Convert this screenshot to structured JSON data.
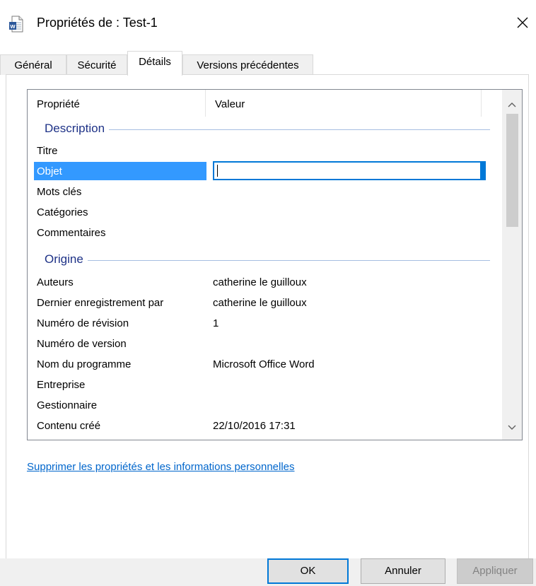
{
  "window": {
    "title": "Propriétés de : Test-1",
    "icon": "word-document-icon",
    "close_symbol": "close-icon"
  },
  "tabs": [
    {
      "label": "Général",
      "active": false
    },
    {
      "label": "Sécurité",
      "active": false
    },
    {
      "label": "Détails",
      "active": true
    },
    {
      "label": "Versions précédentes",
      "active": false
    }
  ],
  "list": {
    "columns": {
      "property": "Propriété",
      "value": "Valeur"
    },
    "groups": {
      "description": "Description",
      "origin": "Origine"
    },
    "rows": [
      {
        "name": "Titre",
        "value": ""
      },
      {
        "name": "Objet",
        "value": "",
        "selected": true,
        "editing": true
      },
      {
        "name": "Mots clés",
        "value": ""
      },
      {
        "name": "Catégories",
        "value": ""
      },
      {
        "name": "Commentaires",
        "value": ""
      },
      {
        "name": "Auteurs",
        "value": "catherine le guilloux"
      },
      {
        "name": "Dernier enregistrement par",
        "value": "catherine le guilloux"
      },
      {
        "name": "Numéro de révision",
        "value": "1"
      },
      {
        "name": "Numéro de version",
        "value": ""
      },
      {
        "name": "Nom du programme",
        "value": "Microsoft Office Word"
      },
      {
        "name": "Entreprise",
        "value": ""
      },
      {
        "name": "Gestionnaire",
        "value": ""
      },
      {
        "name": "Contenu créé",
        "value": "22/10/2016 17:31"
      }
    ]
  },
  "link": {
    "label": "Supprimer les propriétés et les informations personnelles"
  },
  "buttons": {
    "ok": "OK",
    "cancel": "Annuler",
    "apply": "Appliquer"
  },
  "colors": {
    "selection": "#3399ff",
    "group_text": "#1e3287",
    "link": "#0066cc",
    "focus": "#0078d7"
  }
}
